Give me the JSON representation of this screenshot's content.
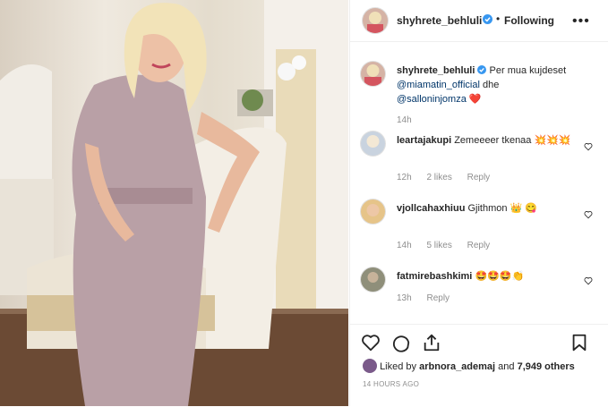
{
  "post": {
    "username": "shyhrete_behluli",
    "following_label": "Following",
    "caption_text": "Per mua kujdeset",
    "caption_mention1": "@miamatin_official",
    "caption_mid": "dhe",
    "caption_mention2": "@salloninjomza",
    "caption_emoji": "❤️",
    "caption_time": "14h"
  },
  "comments": [
    {
      "username": "leartajakupi",
      "text": "Zemeeeer tkenaa 💥💥💥",
      "time": "12h",
      "likes": "2 likes",
      "reply": "Reply",
      "avatar_color": "#c9d3df"
    },
    {
      "username": "vjollcahaxhiuu",
      "text": "Gjithmon 👑 😋",
      "time": "14h",
      "likes": "5 likes",
      "reply": "Reply",
      "avatar_color": "#e6c489"
    },
    {
      "username": "fatmirebashkimi",
      "text": "🤩🤩🤩👏",
      "time": "13h",
      "likes": "",
      "reply": "Reply",
      "avatar_color": "#8f8f7a"
    }
  ],
  "likes": {
    "prefix": "Liked by",
    "user": "arbnora_ademaj",
    "mid": "and",
    "count": "7,949 others"
  },
  "timestamp": "14 HOURS AGO",
  "colors": {
    "blue": "#3897f0",
    "muted": "#8e8e8e",
    "link": "#003569",
    "heart": "#ed4956"
  }
}
